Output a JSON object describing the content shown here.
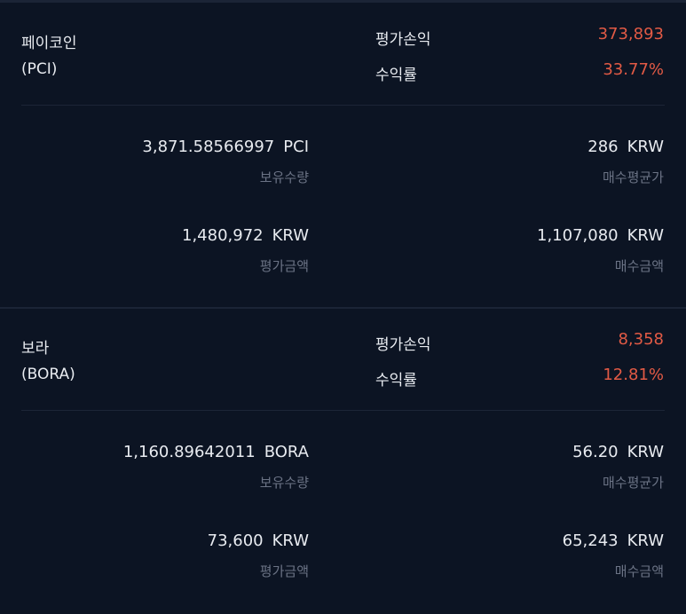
{
  "holdings": [
    {
      "name": "페이코인",
      "symbol": "(PCI)",
      "pl_label": "평가손익",
      "pl_value": "373,893",
      "return_label": "수익률",
      "return_value": "33.77%",
      "quantity": {
        "value": "3,871.58566997",
        "unit": "PCI",
        "label": "보유수량"
      },
      "avg_price": {
        "value": "286",
        "unit": "KRW",
        "label": "매수평균가"
      },
      "eval_amount": {
        "value": "1,480,972",
        "unit": "KRW",
        "label": "평가금액"
      },
      "buy_amount": {
        "value": "1,107,080",
        "unit": "KRW",
        "label": "매수금액"
      }
    },
    {
      "name": "보라",
      "symbol": "(BORA)",
      "pl_label": "평가손익",
      "pl_value": "8,358",
      "return_label": "수익률",
      "return_value": "12.81%",
      "quantity": {
        "value": "1,160.89642011",
        "unit": "BORA",
        "label": "보유수량"
      },
      "avg_price": {
        "value": "56.20",
        "unit": "KRW",
        "label": "매수평균가"
      },
      "eval_amount": {
        "value": "73,600",
        "unit": "KRW",
        "label": "평가금액"
      },
      "buy_amount": {
        "value": "65,243",
        "unit": "KRW",
        "label": "매수금액"
      }
    }
  ],
  "colors": {
    "background": "#0c1423",
    "profit": "#e25a45",
    "text": "#e8ebf0",
    "muted": "#6b7385",
    "divider": "#1b2436"
  }
}
